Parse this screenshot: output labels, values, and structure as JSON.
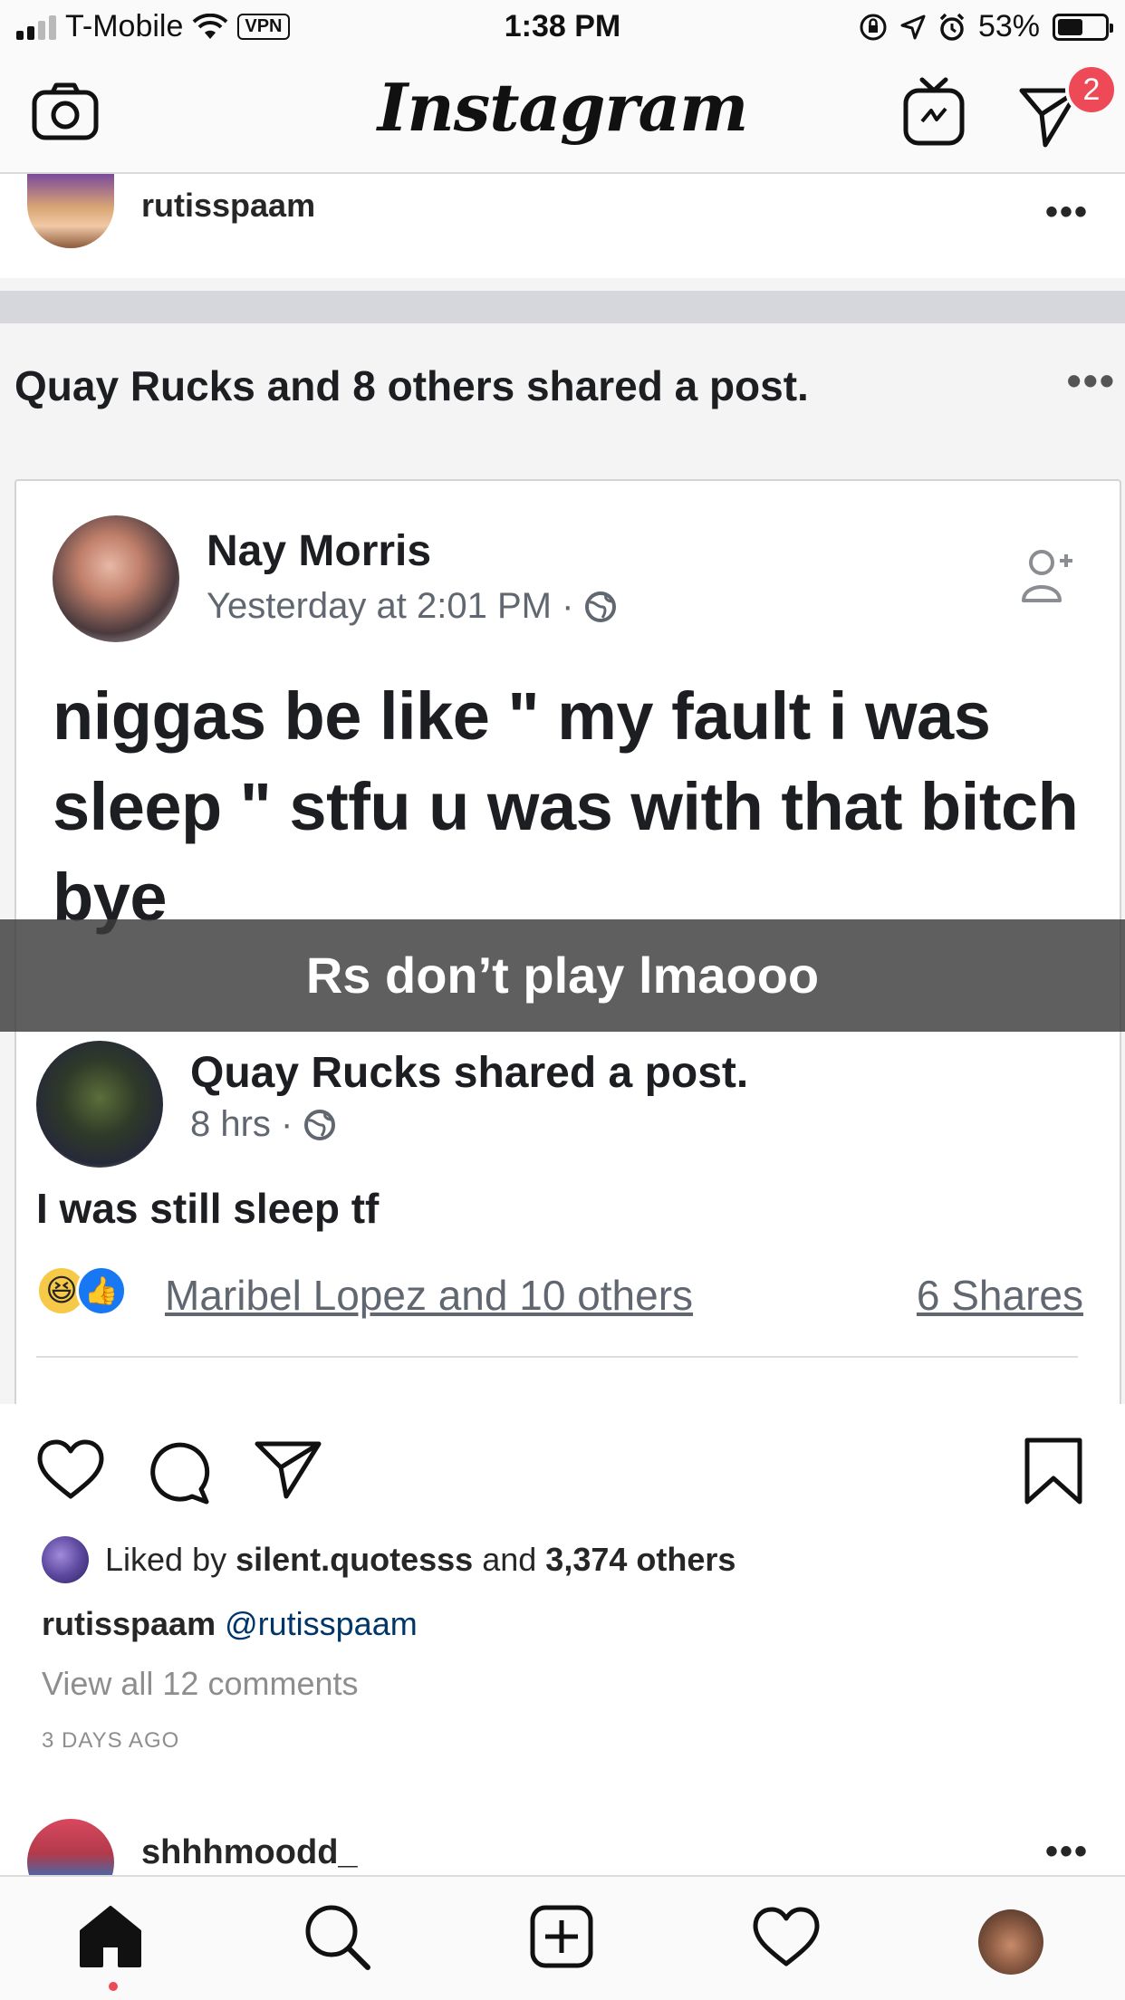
{
  "status_bar": {
    "carrier": "T-Mobile",
    "vpn": "VPN",
    "time": "1:38 PM",
    "battery": "53%",
    "battery_level": 0.53
  },
  "header": {
    "title": "Instagram",
    "direct_badge": "2"
  },
  "post": {
    "username": "rutisspaam",
    "image": {
      "shared_line": "Quay Rucks and 8 others shared a post.",
      "original_author": "Nay Morris",
      "original_meta": "Yesterday at 2:01 PM ·",
      "original_text": "niggas be like \" my fault i was sleep \" stfu u was with that bitch bye",
      "overlay_caption": "Rs don’t play lmaooo",
      "sharer_name": "Quay Rucks",
      "sharer_action": " shared a post.",
      "sharer_meta": "8 hrs ·",
      "sharer_text": "I was still sleep tf",
      "reactions_text": "Maribel Lopez and 10 others",
      "shares_text": "6 Shares"
    },
    "likes": {
      "prefix": "Liked by",
      "user": "silent.quotesss",
      "middle": "and",
      "count": "3,374 others"
    },
    "caption": {
      "username": "rutisspaam",
      "mention": "@rutisspaam"
    },
    "view_comments": "View all 12 comments",
    "timestamp": "3 DAYS AGO"
  },
  "next_post": {
    "username": "shhhmoodd_"
  },
  "tabbar": {
    "items": [
      "home-icon",
      "search-icon",
      "add-icon",
      "heart-icon",
      "profile-avatar"
    ]
  },
  "colors": {
    "accent_red": "#ed4956",
    "mention_blue": "#003569",
    "fb_blue": "#1877f2"
  }
}
